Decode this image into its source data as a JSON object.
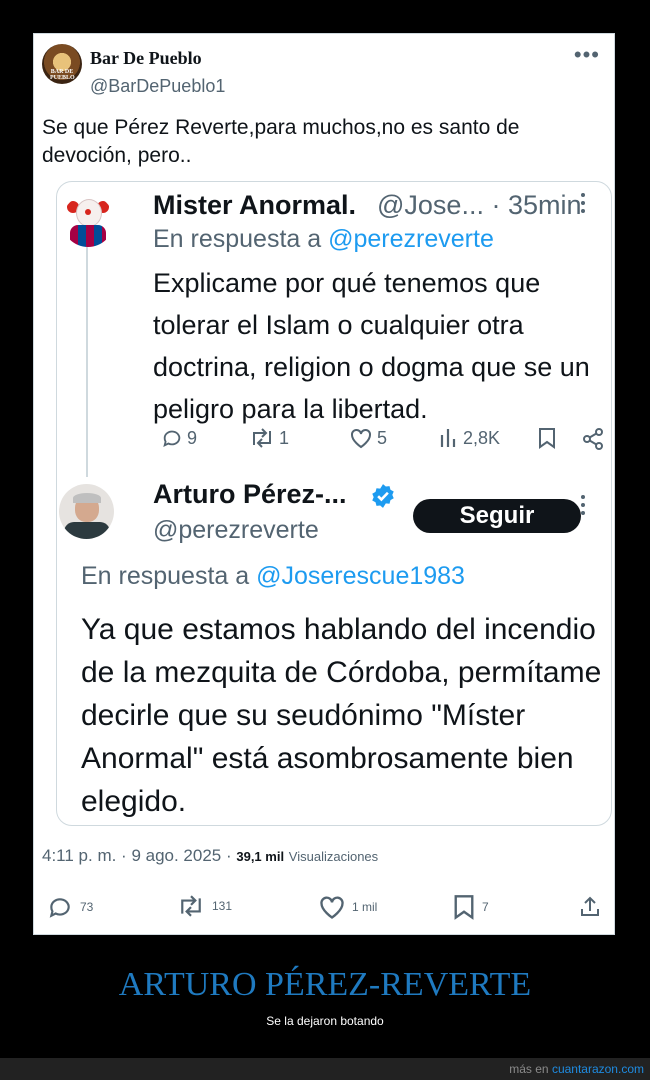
{
  "tweet": {
    "author_name": "Bar De Pueblo",
    "author_handle": "@BarDePueblo1",
    "avatar_logo_text": "BAR DE PUEBLO",
    "text": "Se que Pérez Reverte,para muchos,no es santo de devoción, pero..",
    "more_icon": "more-horizontal-icon",
    "timestamp": "4:11 p. m. · 9 ago. 2025 · ",
    "views_count": "39,1 mil",
    "views_label": "Visualizaciones",
    "actions": {
      "replies": "73",
      "retweets": "131",
      "likes": "1 mil",
      "bookmarks": "7"
    }
  },
  "quote": {
    "reply": {
      "author_name": "Mister Anormal.",
      "author_handle_and_time": "@Jose... · 35min",
      "in_reply_prefix": "En respuesta a ",
      "in_reply_handle": "@perezreverte",
      "text": "Explicame por qué tenemos que tolerar el Islam o cualquier otra doctrina, religion o dogma que se un peligro para la libertad.",
      "actions": {
        "replies": "9",
        "retweets": "1",
        "likes": "5",
        "views": "2,8K"
      }
    },
    "response": {
      "author_name": "Arturo Pérez-...",
      "author_handle": "@perezreverte",
      "follow_label": "Seguir",
      "in_reply_prefix": "En respuesta a ",
      "in_reply_handle": "@Joserescue1983",
      "text": "Ya que estamos hablando del incendio de la mezquita de Córdoba, permítame decirle que su seudónimo \"Míster Anormal\" está asombrosamente bien elegido."
    }
  },
  "caption": {
    "title": "ARTURO PÉREZ-REVERTE",
    "subtitle": "Se la dejaron botando"
  },
  "footer": {
    "prefix": "más en ",
    "site": "cuantarazon.com"
  },
  "colors": {
    "accent": "#1d9bf0",
    "caption_title": "#1f7ac0",
    "text": "#0f1419",
    "muted": "#536471"
  }
}
